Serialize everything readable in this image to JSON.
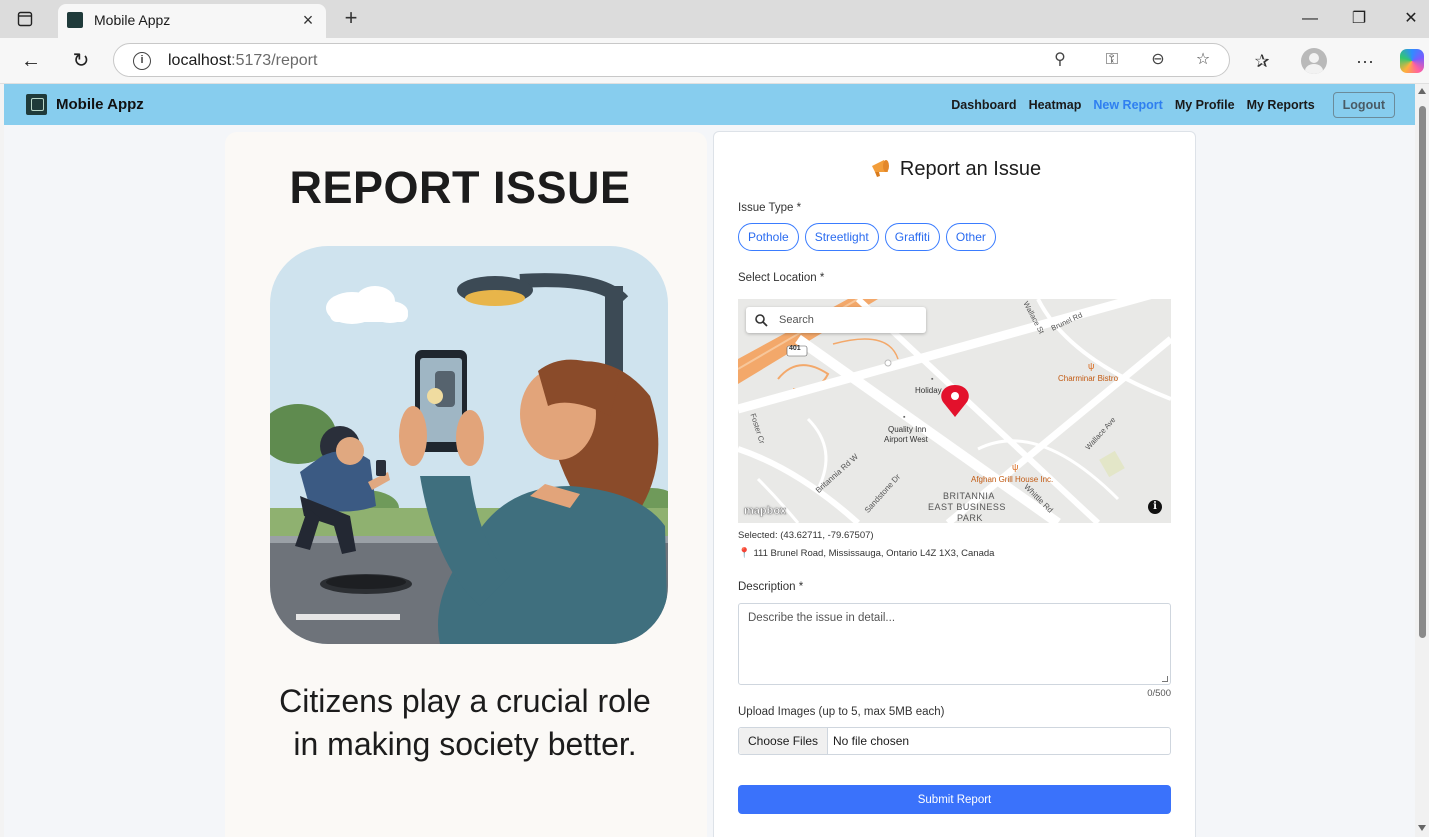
{
  "browser": {
    "tab_title": "Mobile Appz",
    "url_host": "localhost",
    "url_path": ":5173/report"
  },
  "header": {
    "app_name": "Mobile Appz",
    "nav": [
      {
        "label": "Dashboard",
        "active": false
      },
      {
        "label": "Heatmap",
        "active": false
      },
      {
        "label": "New Report",
        "active": true
      },
      {
        "label": "My Profile",
        "active": false
      },
      {
        "label": "My Reports",
        "active": false
      }
    ],
    "logout_label": "Logout",
    "bg_color": "#87cdee",
    "active_color": "#2f7ff0"
  },
  "promo": {
    "title": "REPORT ISSUE",
    "tagline": "Citizens play a crucial role in making society better."
  },
  "form": {
    "title": "Report an Issue",
    "issue_type_label": "Issue Type *",
    "issue_types": [
      "Pothole",
      "Streetlight",
      "Graffiti",
      "Other"
    ],
    "location_label": "Select Location *",
    "map": {
      "search_placeholder": "Search",
      "labels": {
        "hwy": "401",
        "holiday": "Holiday",
        "quality_inn": "Quality Inn",
        "airport_west": "Airport West",
        "charminar": "Charminar Bistro",
        "afghan": "Afghan Grill House Inc.",
        "britannia_park": [
          "BRITANNIA",
          "EAST BUSINESS",
          "PARK"
        ],
        "britannia_rd": "Britannia Rd W",
        "sandstone": "Sandstone Dr",
        "whittle": "Whittle Rd",
        "wallace_st": "Wallace St",
        "brunel_rd": "Brunel Rd",
        "wallace_ave": "Wallace Ave",
        "foster": "Foster Cr"
      },
      "attribution": "mapbox",
      "info_glyph": "i"
    },
    "selected_text": "Selected: (43.62711, -79.67507)",
    "address_text": "111 Brunel Road, Mississauga, Ontario L4Z 1X3, Canada",
    "description_label": "Description *",
    "description_placeholder": "Describe the issue in detail...",
    "description_value": "",
    "char_count": "0/500",
    "upload_label": "Upload Images (up to 5, max 5MB each)",
    "choose_files_label": "Choose Files",
    "no_file_text": "No file chosen",
    "submit_label": "Submit Report",
    "accent_color": "#3a72fb"
  },
  "icons": {
    "tab_close": "×",
    "new_tab": "+",
    "back": "←",
    "reload": "↻",
    "minimize": "—",
    "restore": "❐",
    "close": "✕",
    "more": "···",
    "location": "⚲",
    "key": "⚿",
    "zoom": "⊖",
    "star": "☆",
    "favorites": "✰",
    "info": "i",
    "pin": "📍"
  }
}
